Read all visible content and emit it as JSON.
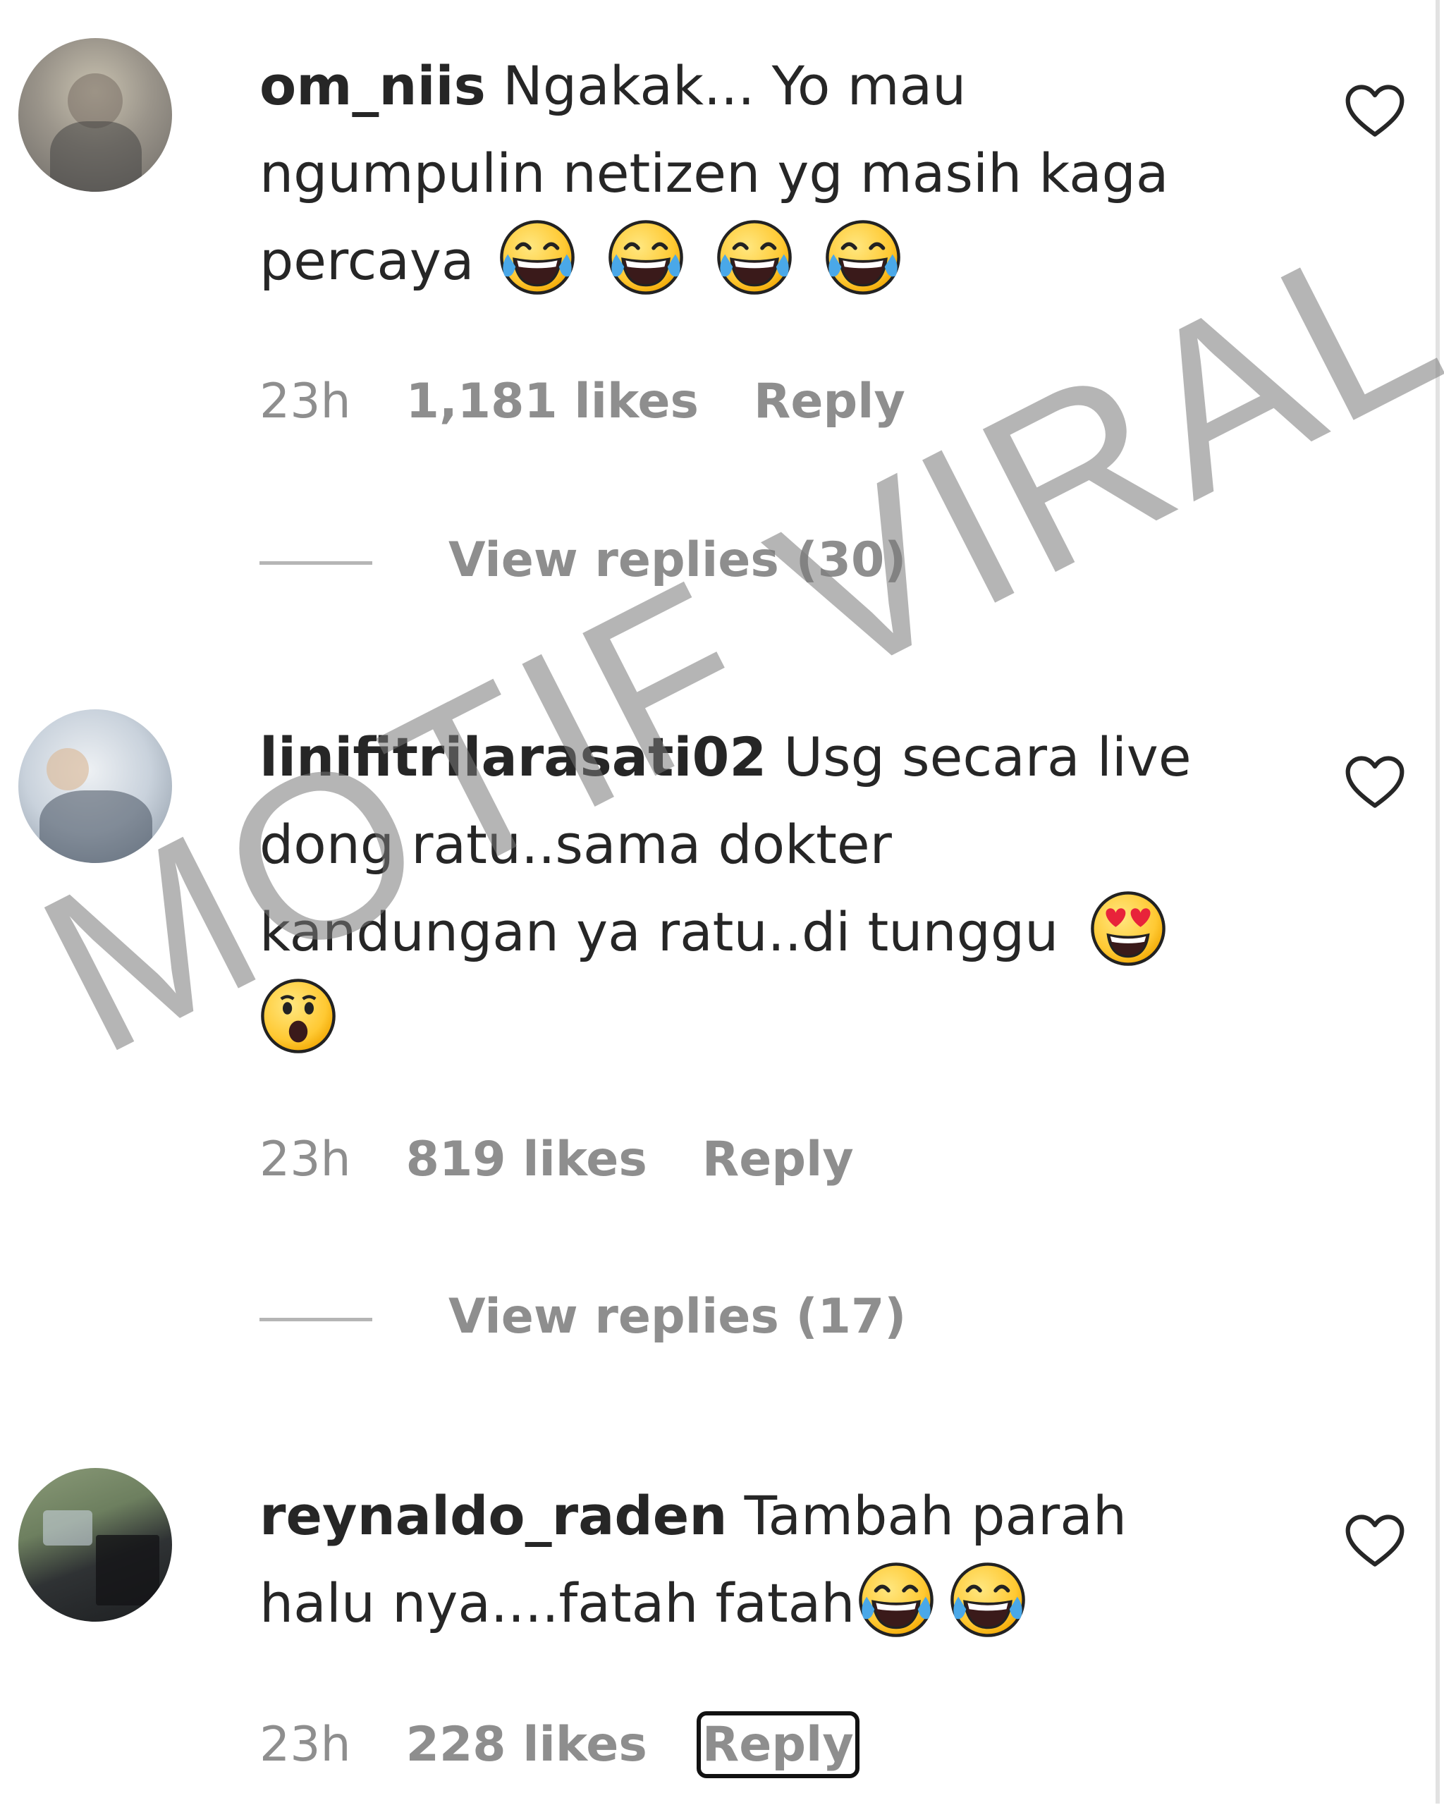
{
  "comments": [
    {
      "username": "om_niis",
      "text_lines": [
        "Ngakak... Yo mau",
        "ngumpulin netizen yg masih kaga",
        "percaya"
      ],
      "emojis": [
        "tears-of-joy",
        "tears-of-joy",
        "tears-of-joy",
        "tears-of-joy"
      ],
      "time": "23h",
      "likes": "1,181 likes",
      "reply": "Reply",
      "view_replies": "View replies (30)"
    },
    {
      "username": "linifitrilarasati02",
      "text_lines": [
        "Usg secara live",
        "dong ratu..sama dokter",
        "kandungan ya ratu..di tunggu"
      ],
      "emojis": [
        "heart-eyes",
        "astonished"
      ],
      "time": "23h",
      "likes": "819 likes",
      "reply": "Reply",
      "view_replies": "View replies (17)"
    },
    {
      "username": "reynaldo_raden",
      "text_lines": [
        "Tambah parah",
        "halu nya....fatah fatah"
      ],
      "emojis": [
        "tears-of-joy",
        "tears-of-joy"
      ],
      "time": "23h",
      "likes": "228 likes",
      "reply": "Reply"
    }
  ],
  "watermark": "MOTIF VIRAL",
  "colors": {
    "text": "#262626",
    "meta": "#8e8e8e",
    "emoji_face": "#ffcc33"
  },
  "icons": [
    "heart-outline-icon"
  ]
}
